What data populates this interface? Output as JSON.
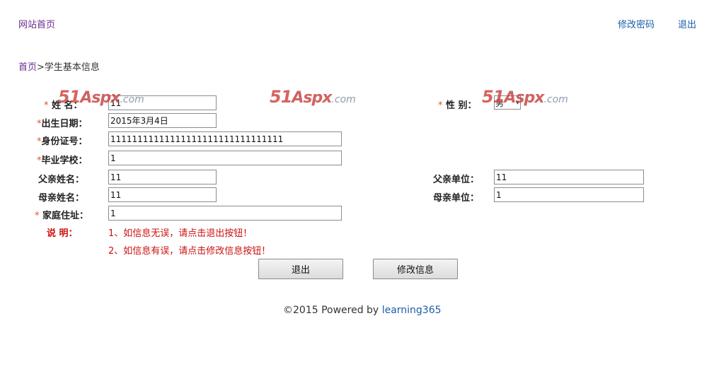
{
  "header": {
    "home_link": "网站首页",
    "change_password": "修改密码",
    "logout": "退出"
  },
  "breadcrumb": {
    "home": "首页",
    "separator": ">",
    "current": "学生基本信息"
  },
  "form": {
    "required_mark": "*",
    "name": {
      "label": "姓 名：",
      "value": "11"
    },
    "gender": {
      "label": "性 别：",
      "value": "男"
    },
    "birth_date": {
      "label": "出生日期：",
      "value": "2015年3月4日"
    },
    "id_number": {
      "label": "身份证号：",
      "value": "11111111111111111111111111111111"
    },
    "school": {
      "label": "毕业学校：",
      "value": "1"
    },
    "father_name": {
      "label": "父亲姓名：",
      "value": "11"
    },
    "father_work": {
      "label": "父亲单位：",
      "value": "11"
    },
    "mother_name": {
      "label": "母亲姓名：",
      "value": "11"
    },
    "mother_work": {
      "label": "母亲单位：",
      "value": "1"
    },
    "address": {
      "label": "家庭住址：",
      "value": "1"
    }
  },
  "notes": {
    "label": "说 明：",
    "line1": "1、如信息无误，请点击退出按钮！",
    "line2": "2、如信息有误，请点击修改信息按钮！"
  },
  "buttons": {
    "exit": "退出",
    "edit": "修改信息"
  },
  "footer": {
    "prefix": "©2015 Powered by",
    "link": "learning365"
  },
  "watermark": {
    "number": "51",
    "brand": "Aspx",
    "domain": ".com"
  },
  "colors": {
    "link_blue": "#1a5fa8",
    "link_purple": "#6b2c91",
    "required_orange": "#e0561b",
    "note_red": "#cc1111"
  }
}
